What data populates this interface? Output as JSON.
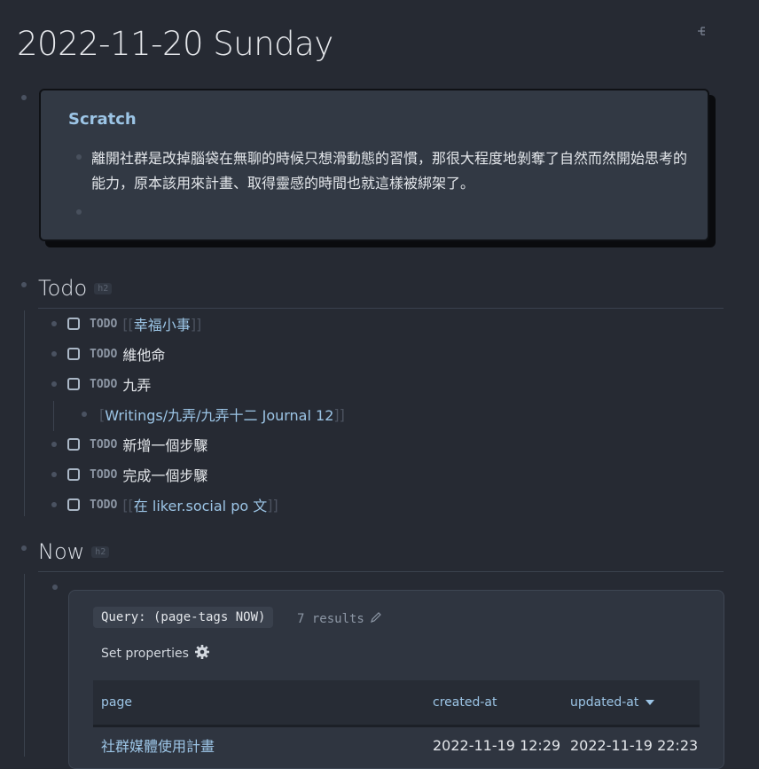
{
  "page": {
    "title": "2022-11-20 Sunday",
    "graph_icon": "graph-view-icon"
  },
  "scratch": {
    "title": "Scratch",
    "text": "離開社群是改掉腦袋在無聊的時候只想滑動態的習慣，那很大程度地剝奪了自然而然開始思考的能力，原本該用來計畫、取得靈感的時間也就這樣被綁架了。"
  },
  "todo_section": {
    "heading": "Todo",
    "tag": "h2",
    "keyword": "TODO",
    "items": [
      {
        "text": "幸福小事",
        "is_link": true
      },
      {
        "text": "維他命",
        "is_link": false
      },
      {
        "text": "九弄",
        "is_link": false
      },
      {
        "text": "新增一個步驟",
        "is_link": false
      },
      {
        "text": "完成一個步驟",
        "is_link": false
      },
      {
        "text": "在 liker.social po 文",
        "is_link": true
      }
    ],
    "child_link": "Writings/九弄/九弄十二 Journal 12"
  },
  "now_section": {
    "heading": "Now",
    "tag": "h2",
    "query": {
      "label": "Query: (page-tags NOW)",
      "results": "7 results",
      "set_properties": "Set properties",
      "columns": [
        "page",
        "created-at",
        "updated-at"
      ],
      "rows": [
        {
          "page": "社群媒體使用計畫",
          "created_at": "2022-11-19 12:29",
          "updated_at": "2022-11-19 22:23"
        }
      ]
    }
  },
  "colors": {
    "background": "#262a33",
    "link": "#9cc5e6",
    "callout": "#323944"
  }
}
